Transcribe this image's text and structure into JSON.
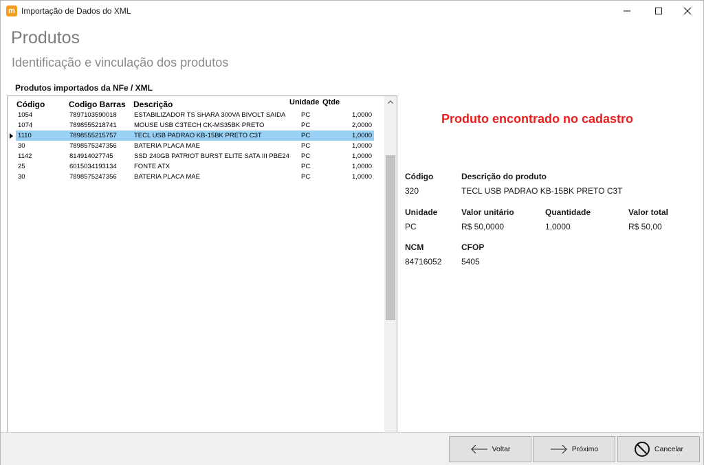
{
  "window": {
    "title": "Importação de Dados do XML",
    "app_icon_letter": "m"
  },
  "page": {
    "title": "Produtos",
    "subtitle": "Identificação e vinculação dos produtos"
  },
  "list": {
    "caption": "Produtos importados da NFe / XML",
    "headers": {
      "codigo": "Código",
      "codigo_barras": "Codigo Barras",
      "descricao": "Descrição",
      "unidade": "Unidade",
      "qtde": "Qtde"
    },
    "selected_index": 2,
    "rows": [
      {
        "codigo": "1054",
        "codigo_barras": "7897103590018",
        "descricao": "ESTABILIZADOR TS SHARA 300VA BIVOLT SAIDA",
        "unidade": "PC",
        "qtde": "1,0000"
      },
      {
        "codigo": "1074",
        "codigo_barras": "7898555218741",
        "descricao": "MOUSE USB C3TECH CK-MS35BK PRETO",
        "unidade": "PC",
        "qtde": "2,0000"
      },
      {
        "codigo": "1110",
        "codigo_barras": "7898555215757",
        "descricao": "TECL USB PADRAO KB-15BK PRETO C3T",
        "unidade": "PC",
        "qtde": "1,0000"
      },
      {
        "codigo": "30",
        "codigo_barras": "7898575247356",
        "descricao": "BATERIA PLACA MAE",
        "unidade": "PC",
        "qtde": "1,0000"
      },
      {
        "codigo": "1142",
        "codigo_barras": "814914027745",
        "descricao": "SSD 240GB PATRIOT BURST ELITE SATA III PBE24",
        "unidade": "PC",
        "qtde": "1,0000"
      },
      {
        "codigo": "25",
        "codigo_barras": "6015034193134",
        "descricao": "FONTE ATX",
        "unidade": "PC",
        "qtde": "1,0000"
      },
      {
        "codigo": "30",
        "codigo_barras": "7898575247356",
        "descricao": "BATERIA PLACA MAE",
        "unidade": "PC",
        "qtde": "1,0000"
      }
    ]
  },
  "detail": {
    "status": "Produto encontrado no cadastro",
    "codigo_label": "Código",
    "codigo_value": "320",
    "descricao_label": "Descrição do produto",
    "descricao_value": "TECL USB PADRAO KB-15BK PRETO C3T",
    "unidade_label": "Unidade",
    "unidade_value": "PC",
    "valor_unitario_label": "Valor unitário",
    "valor_unitario_value": "R$ 50,0000",
    "quantidade_label": "Quantidade",
    "quantidade_value": "1,0000",
    "valor_total_label": "Valor total",
    "valor_total_value": "R$ 50,00",
    "ncm_label": "NCM",
    "ncm_value": "84716052",
    "cfop_label": "CFOP",
    "cfop_value": "5405"
  },
  "footer": {
    "voltar_label": "Voltar",
    "proximo_label": "Próximo",
    "cancelar_label": "Cancelar"
  },
  "colors": {
    "status_red": "#ee1c1c",
    "selection_blue": "#99d1f5",
    "app_icon_orange": "#f39c1f"
  },
  "icons": {
    "app": "app-logo-icon",
    "minimize": "minimize-icon",
    "maximize": "maximize-icon",
    "close": "close-icon",
    "back": "arrow-left-icon",
    "next": "arrow-right-icon",
    "cancel": "prohibited-icon"
  }
}
